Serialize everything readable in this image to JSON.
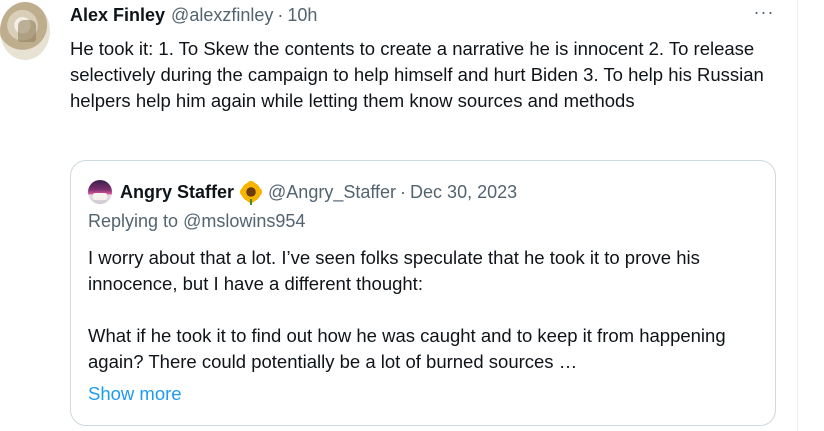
{
  "tweet": {
    "author_name": "Alex Finley",
    "author_handle": "@alexzfinley",
    "separator": "·",
    "time": "10h",
    "more_label": "···",
    "text": "He took it: 1. To Skew the contents to create a narrative he is innocent 2. To release selectively during the campaign to help himself and hurt Biden 3. To help his Russian helpers help him again while letting them know sources and methods"
  },
  "quoted": {
    "author_name": "Angry Staffer",
    "emoji": "sunflower-icon",
    "author_handle": "@Angry_Staffer",
    "separator": "·",
    "date": "Dec 30, 2023",
    "replying_prefix": "Replying to ",
    "replying_to": "@mslowins954",
    "paragraph_1": "I worry about that a lot. I’ve seen folks speculate that he took it to prove his innocence, but I have a different thought:",
    "paragraph_2": "What if he took it to find out how he was caught and to keep it from happening again? There could potentially be a lot of burned sources …",
    "show_more": "Show more"
  },
  "colors": {
    "text": "#0f1419",
    "secondary": "#536471",
    "link": "#1d9bf0",
    "border": "#cfd9de"
  }
}
